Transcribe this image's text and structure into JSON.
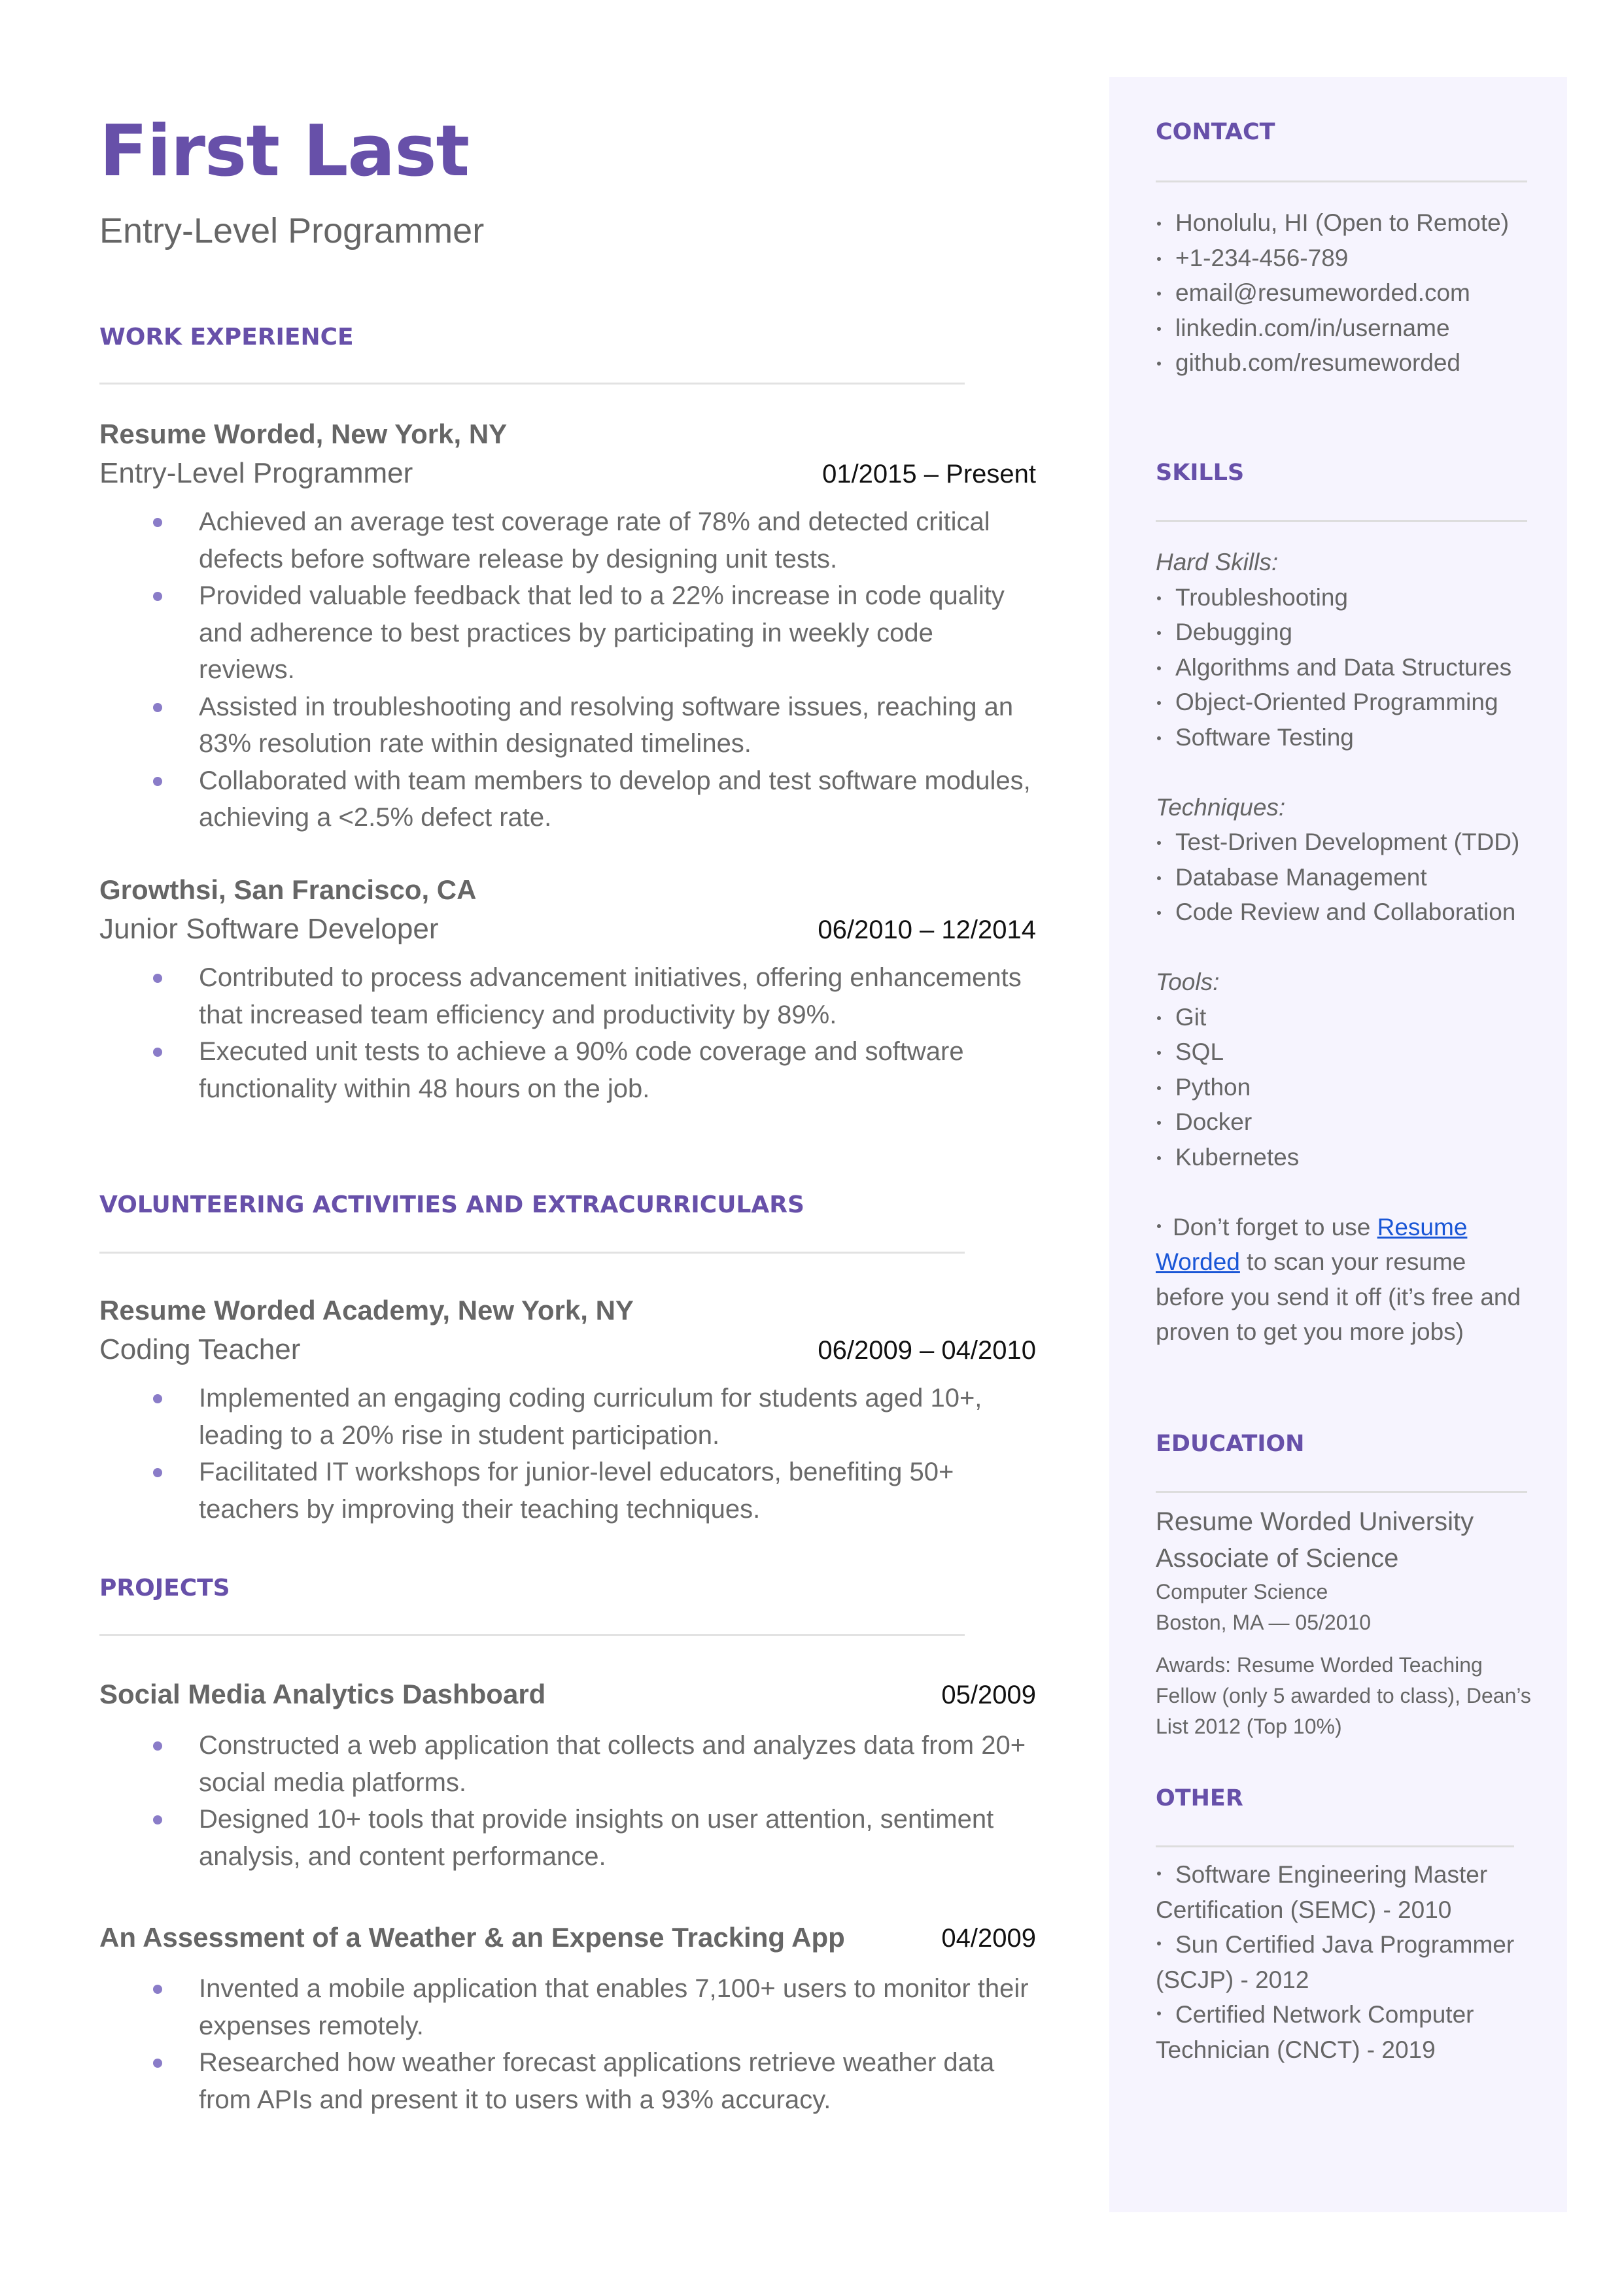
{
  "header": {
    "name": "First Last",
    "title": "Entry-Level Programmer"
  },
  "colors": {
    "accent": "#6750a9",
    "bullet": "#8a7cc8",
    "sidebar_bg": "#f6f4fe",
    "link": "#1a56d6",
    "body_text": "#666666"
  },
  "sections": {
    "work_experience": {
      "heading": "WORK EXPERIENCE",
      "entries": [
        {
          "org": "Resume Worded, New York, NY",
          "role": "Entry-Level Programmer",
          "dates": "01/2015 – Present",
          "bullets": [
            "Achieved an average test coverage rate of 78% and detected critical defects before software release by designing unit tests.",
            "Provided valuable feedback that led to a 22% increase in code quality and adherence to best practices by participating in weekly code reviews.",
            "Assisted in troubleshooting and resolving software issues, reaching an 83% resolution rate within designated timelines.",
            "Collaborated with team members to develop and test software modules, achieving a <2.5% defect rate."
          ]
        },
        {
          "org": "Growthsi, San Francisco, CA",
          "role": "Junior Software Developer",
          "dates": "06/2010 – 12/2014",
          "bullets": [
            "Contributed to process advancement initiatives, offering enhancements that increased team efficiency and productivity by 89%.",
            "Executed unit tests to achieve a 90% code coverage and software functionality within 48 hours on the job."
          ]
        }
      ]
    },
    "volunteering": {
      "heading": "VOLUNTEERING ACTIVITIES AND EXTRACURRICULARS",
      "entries": [
        {
          "org": "Resume Worded Academy, New York, NY",
          "role": "Coding Teacher",
          "dates": "06/2009 – 04/2010",
          "bullets": [
            "Implemented an engaging coding curriculum for students aged 10+, leading to a 20% rise in student participation.",
            "Facilitated IT workshops for junior-level educators, benefiting 50+ teachers by improving their teaching techniques."
          ]
        }
      ]
    },
    "projects": {
      "heading": "PROJECTS",
      "entries": [
        {
          "title": "Social Media Analytics Dashboard",
          "date": "05/2009",
          "bullets": [
            "Constructed a web application that collects and analyzes data from 20+ social media platforms.",
            "Designed 10+ tools that provide insights on user attention, sentiment analysis, and content performance."
          ]
        },
        {
          "title": "An Assessment of a Weather & an Expense Tracking App",
          "date": "04/2009",
          "bullets": [
            "Invented a mobile application that enables 7,100+ users to monitor their expenses remotely.",
            "Researched how weather forecast applications retrieve weather data from APIs and present it to users with a 93% accuracy."
          ]
        }
      ]
    }
  },
  "sidebar": {
    "contact": {
      "heading": "CONTACT",
      "items": [
        "Honolulu, HI (Open to Remote)",
        "+1-234-456-789",
        "email@resumeworded.com",
        "linkedin.com/in/username",
        "github.com/resumeworded"
      ]
    },
    "skills": {
      "heading": "SKILLS",
      "hard_label": "Hard Skills:",
      "hard": [
        "Troubleshooting",
        "Debugging",
        "Algorithms and Data Structures",
        "Object-Oriented Programming",
        "Software Testing"
      ],
      "techniques_label": "Techniques:",
      "techniques": [
        "Test-Driven Development (TDD)",
        "Database Management",
        "Code Review and Collaboration"
      ],
      "tools_label": "Tools:",
      "tools": [
        "Git",
        "SQL",
        "Python",
        "Docker",
        "Kubernetes"
      ],
      "note_before": "Don’t forget to use ",
      "note_link": "Resume Worded",
      "note_after": " to scan your resume before you send it off (it’s free and proven to get you more jobs)"
    },
    "education": {
      "heading": "EDUCATION",
      "school": "Resume Worded University",
      "degree": "Associate of Science",
      "field": "Computer Science",
      "location_date": "Boston, MA — 05/2010",
      "awards": "Awards: Resume Worded Teaching Fellow (only 5 awarded to class), Dean’s List 2012 (Top 10%)"
    },
    "other": {
      "heading": "OTHER",
      "items": [
        "Software Engineering Master Certification (SEMC) - 2010",
        "Sun Certified Java Programmer (SCJP) - 2012",
        "Certified Network Computer Technician (CNCT) - 2019"
      ]
    }
  }
}
